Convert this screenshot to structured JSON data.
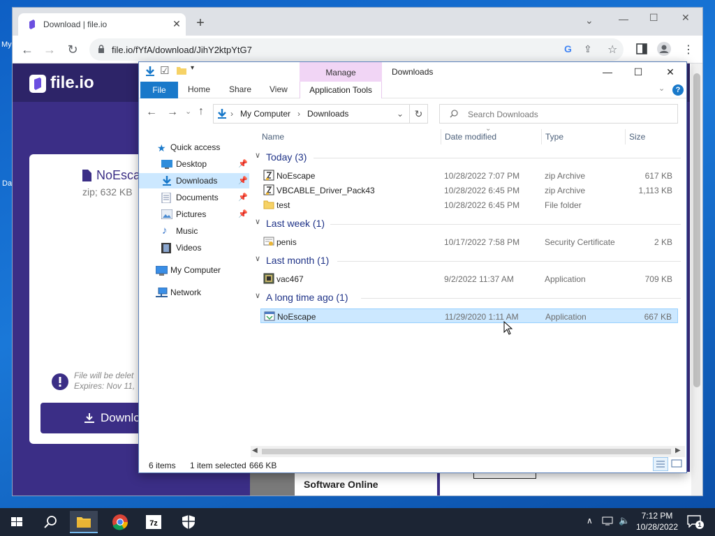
{
  "desktop": {
    "icon_labels": [
      "My",
      "Da"
    ]
  },
  "browser": {
    "tab_title": "Download | file.io",
    "url": "file.io/fYfA/download/JihY2ktpYtG7",
    "page": {
      "logo": "file.io",
      "file_name": "NoEsca",
      "file_meta": "zip; 632 KB",
      "expiry_line1": "File will be delet",
      "expiry_line2": "Expires: Nov 11, ",
      "download_label": "Downlo",
      "ad_text": "Software Online"
    }
  },
  "explorer": {
    "title": "Downloads",
    "manage_label": "Manage",
    "ribbon_tabs": [
      "File",
      "Home",
      "Share",
      "View",
      "Application Tools"
    ],
    "breadcrumb": [
      "My Computer",
      "Downloads"
    ],
    "search_placeholder": "Search Downloads",
    "nav": {
      "quick_access": "Quick access",
      "desktop": "Desktop",
      "downloads": "Downloads",
      "documents": "Documents",
      "pictures": "Pictures",
      "music": "Music",
      "videos": "Videos",
      "my_computer": "My Computer",
      "network": "Network"
    },
    "columns": {
      "name": "Name",
      "date": "Date modified",
      "type": "Type",
      "size": "Size"
    },
    "groups": [
      {
        "label": "Today (3)",
        "files": [
          {
            "name": "NoEscape",
            "date": "10/28/2022 7:07 PM",
            "type": "zip Archive",
            "size": "617 KB",
            "icon": "zip-archive-icon"
          },
          {
            "name": "VBCABLE_Driver_Pack43",
            "date": "10/28/2022 6:45 PM",
            "type": "zip Archive",
            "size": "1,113 KB",
            "icon": "zip-archive-icon"
          },
          {
            "name": "test",
            "date": "10/28/2022 6:45 PM",
            "type": "File folder",
            "size": "",
            "icon": "folder-icon"
          }
        ]
      },
      {
        "label": "Last week (1)",
        "files": [
          {
            "name": "penis",
            "date": "10/17/2022 7:58 PM",
            "type": "Security Certificate",
            "size": "2 KB",
            "icon": "certificate-icon"
          }
        ]
      },
      {
        "label": "Last month (1)",
        "files": [
          {
            "name": "vac467",
            "date": "9/2/2022 11:37 AM",
            "type": "Application",
            "size": "709 KB",
            "icon": "application-icon"
          }
        ]
      },
      {
        "label": "A long time ago (1)",
        "files": [
          {
            "name": "NoEscape",
            "date": "11/29/2020 1:11 AM",
            "type": "Application",
            "size": "667 KB",
            "icon": "application-icon",
            "selected": true
          }
        ]
      }
    ],
    "status": {
      "items": "6 items",
      "selected": "1 item selected",
      "size": "666 KB"
    }
  },
  "taskbar": {
    "time": "7:12 PM",
    "date": "10/28/2022",
    "notification_count": "1",
    "app_icons": [
      "start-icon",
      "search-icon",
      "file-explorer-icon",
      "chrome-icon",
      "7zip-icon",
      "security-shield-icon"
    ]
  },
  "colors": {
    "fileio_brand": "#3b2e86",
    "explorer_accent": "#1979ca",
    "selection": "#cce8ff",
    "manage_tab": "#f1d5f5"
  }
}
